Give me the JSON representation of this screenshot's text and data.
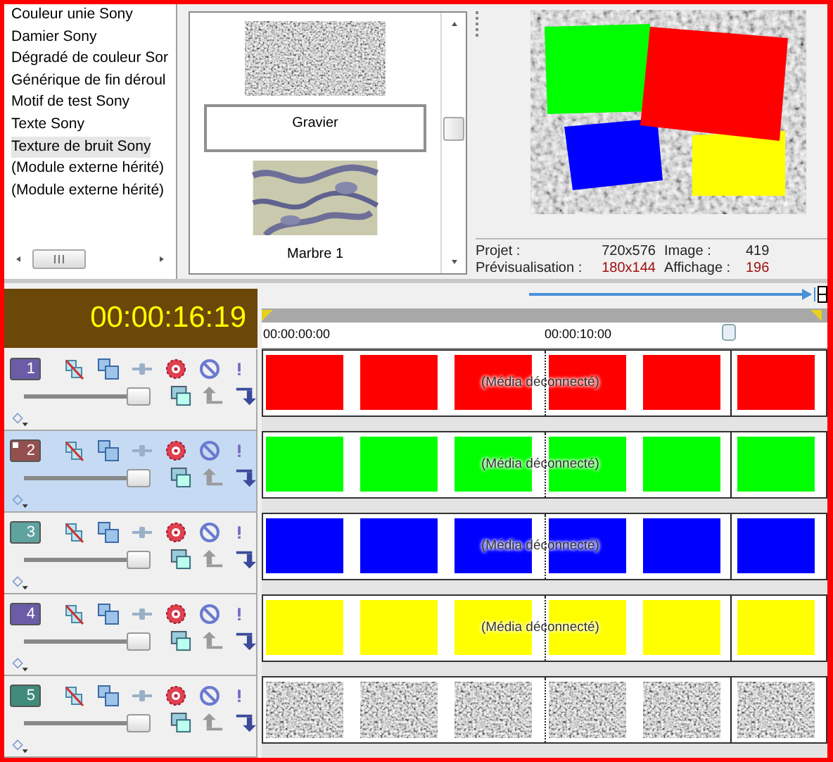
{
  "effects_list": {
    "items": [
      {
        "label": "Couleur unie Sony",
        "selected": false
      },
      {
        "label": "Damier Sony",
        "selected": false
      },
      {
        "label": "Dégradé de couleur Sor",
        "selected": false
      },
      {
        "label": "Générique de fin déroul",
        "selected": false
      },
      {
        "label": "Motif de test Sony",
        "selected": false
      },
      {
        "label": "Texte Sony",
        "selected": false
      },
      {
        "label": "Texture de bruit Sony",
        "selected": true
      },
      {
        "label": "(Module externe hérité)",
        "selected": false
      },
      {
        "label": "(Module externe hérité)",
        "selected": false
      }
    ]
  },
  "presets": {
    "items": [
      {
        "label": "Gravier",
        "selected": true,
        "kind": "noise"
      },
      {
        "label": "Marbre 1",
        "selected": false,
        "kind": "marble"
      }
    ]
  },
  "preview": {
    "info": [
      {
        "label": "Projet :",
        "value": "720x576",
        "highlight": false
      },
      {
        "label": "Image :",
        "value": "419",
        "highlight": false
      },
      {
        "label": "Prévisualisation :",
        "value": "180x144",
        "highlight": true
      },
      {
        "label": "Affichage :",
        "value": "196",
        "highlight": true
      }
    ]
  },
  "timecode": "00:00:16:19",
  "ruler": {
    "labels": [
      "00:00:00:00",
      "00:00:10:00"
    ]
  },
  "tracks": [
    {
      "number": "1",
      "color": "#6a5ca6",
      "selected": false,
      "level": 0.88,
      "clip": {
        "kind": "solid",
        "color": "#ff0000"
      },
      "clip_label": "(Média déconnecté)"
    },
    {
      "number": "2",
      "color": "#94504e",
      "selected": true,
      "level": 0.88,
      "clip": {
        "kind": "solid",
        "color": "#00ff00"
      },
      "clip_label": "(Média déconnecté)"
    },
    {
      "number": "3",
      "color": "#5fa39f",
      "selected": false,
      "level": 0.88,
      "clip": {
        "kind": "solid",
        "color": "#0000ff"
      },
      "clip_label": "(Média déconnecté)"
    },
    {
      "number": "4",
      "color": "#6a5ca6",
      "selected": false,
      "level": 0.88,
      "clip": {
        "kind": "solid",
        "color": "#ffff00"
      },
      "clip_label": "(Média déconnecté)"
    },
    {
      "number": "5",
      "color": "#3f8a7a",
      "selected": false,
      "level": 0.88,
      "clip": {
        "kind": "noise"
      }
    }
  ]
}
